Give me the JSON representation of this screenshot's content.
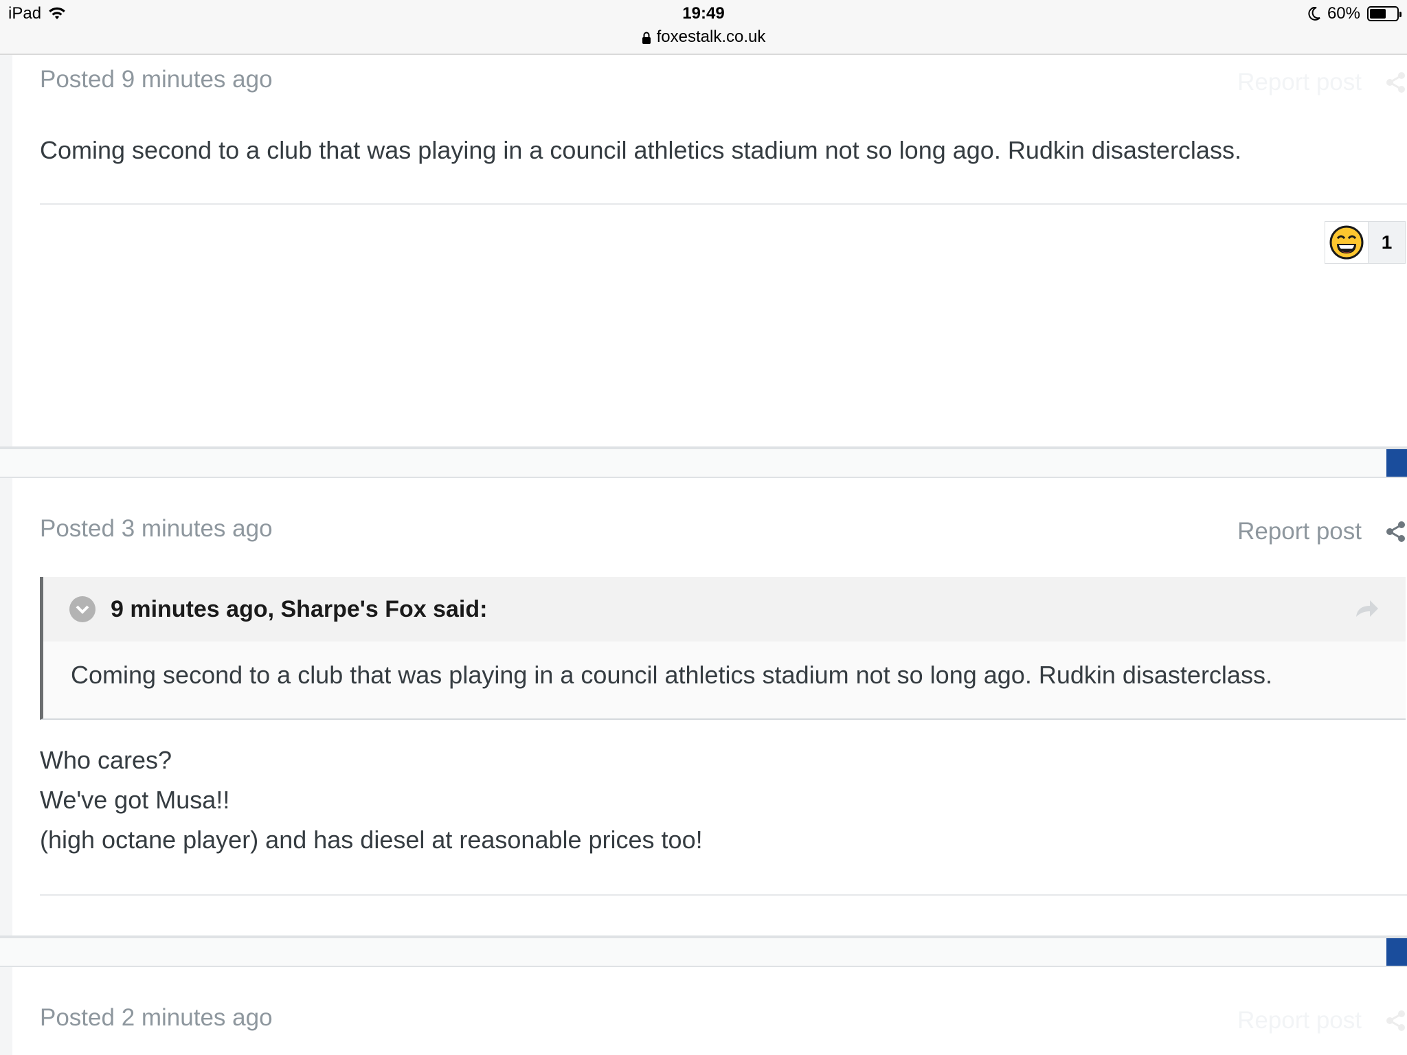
{
  "status_bar": {
    "device": "iPad",
    "time": "19:49",
    "url": "foxestalk.co.uk",
    "battery": "60%"
  },
  "posts": [
    {
      "meta": "Posted 9 minutes ago",
      "report": "Report post",
      "body": "Coming second to a club that was playing in a council athletics stadium not so long ago. Rudkin disasterclass.",
      "reaction": {
        "icon": "laughing-face-icon",
        "count": "1"
      }
    },
    {
      "meta": "Posted 3 minutes ago",
      "report": "Report post",
      "quote": {
        "citation": "9 minutes ago, Sharpe's Fox said:",
        "text": "Coming second to a club that was playing in a council athletics stadium not so long ago. Rudkin disasterclass."
      },
      "lines": [
        "Who cares?",
        "We've got Musa!!",
        "(high octane player) and has diesel at reasonable prices too!"
      ]
    },
    {
      "meta": "Posted 2 minutes ago",
      "report": "Report post"
    }
  ],
  "colors": {
    "accent": "#1a4d9c",
    "meta_text": "#8e979e",
    "body_text": "#353c41"
  }
}
